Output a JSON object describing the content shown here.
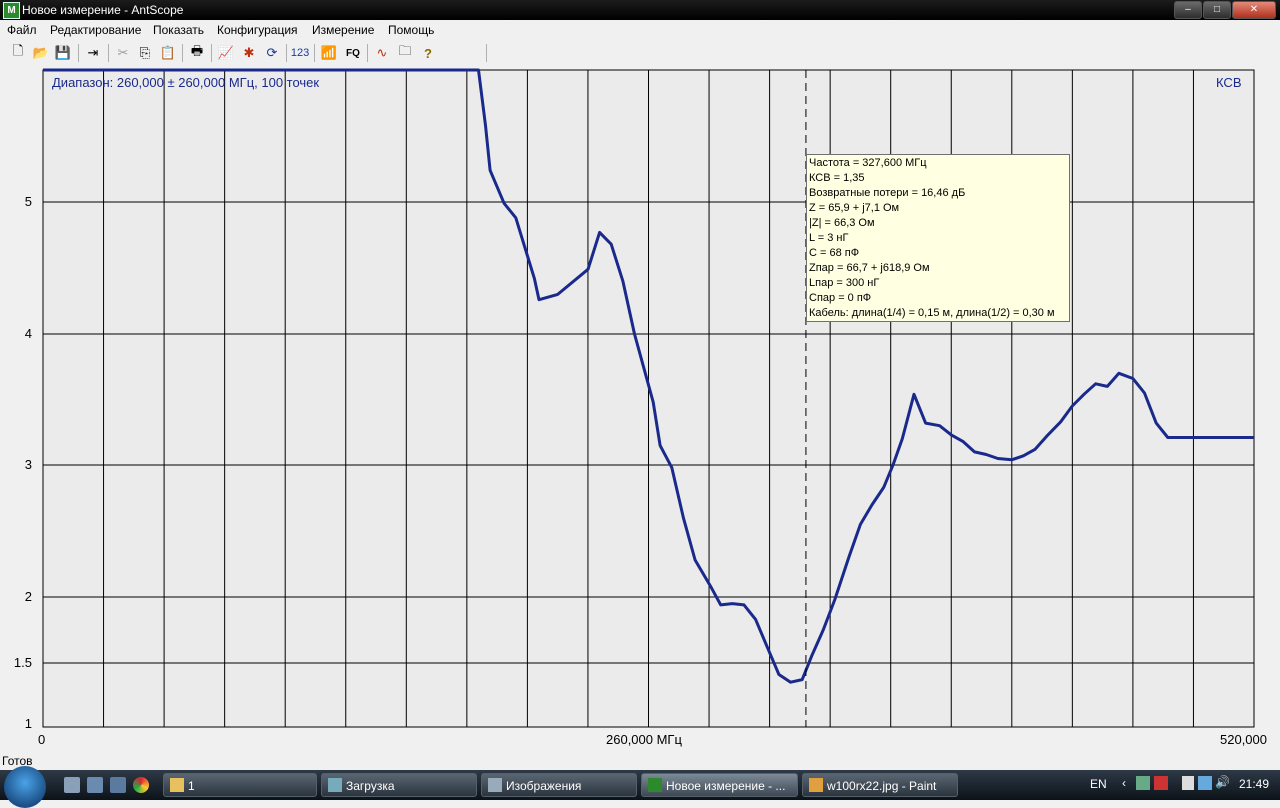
{
  "window": {
    "title": "Новое измерение - AntScope",
    "app_icon": "antscope-icon",
    "controls": {
      "minimize": "–",
      "maximize": "□",
      "close": "✕"
    }
  },
  "menu": [
    "Файл",
    "Редактирование",
    "Показать",
    "Конфигурация",
    "Измерение",
    "Помощь"
  ],
  "toolbar": {
    "buttons": [
      {
        "name": "new-file-icon",
        "glyph": "🗋"
      },
      {
        "name": "open-folder-icon",
        "glyph": "📂"
      },
      {
        "name": "save-icon",
        "glyph": "💾"
      },
      {
        "name": "export-icon",
        "glyph": "⇥"
      },
      {
        "name": "cut-icon",
        "glyph": "✂"
      },
      {
        "name": "copy-icon",
        "glyph": "⎘"
      },
      {
        "name": "paste-icon",
        "glyph": "📋"
      },
      {
        "name": "print-icon",
        "glyph": "🖶"
      },
      {
        "name": "chart-icon",
        "glyph": "📈"
      },
      {
        "name": "star-icon",
        "glyph": "✱"
      },
      {
        "name": "refresh-icon",
        "glyph": "⟳"
      },
      {
        "name": "numbers-icon",
        "glyph": "123"
      },
      {
        "name": "antenna-icon",
        "glyph": "📶"
      },
      {
        "name": "fq-icon",
        "glyph": "FQ"
      },
      {
        "name": "waves-icon",
        "glyph": "∿"
      },
      {
        "name": "folder-list-icon",
        "glyph": "🗀"
      },
      {
        "name": "help-icon",
        "glyph": "?"
      }
    ]
  },
  "plot": {
    "range_label": "Диапазон: 260,000 ± 260,000 МГц, 100 точек",
    "mode_label": "КСВ",
    "x_labels": {
      "left": "0",
      "center": "260,000 МГц",
      "right": "520,000"
    },
    "line_color": "#1a2a8c"
  },
  "chart_data": {
    "type": "line",
    "xlabel": "МГц",
    "ylabel": "КСВ",
    "xlim": [
      0,
      520
    ],
    "y_ticks": [
      "1",
      "1.5",
      "2",
      "3",
      "4",
      "5"
    ],
    "cursor_x": 327.6,
    "series": [
      {
        "x": [
          0,
          187,
          190,
          192,
          198,
          203,
          211,
          213,
          221,
          234,
          239,
          244,
          249,
          254,
          262,
          265,
          270,
          275,
          280,
          287,
          291,
          296,
          301,
          306,
          311,
          316,
          321,
          326,
          330,
          335,
          340,
          346,
          351,
          356,
          361,
          365,
          369,
          374,
          379,
          385,
          390,
          395,
          400,
          405,
          410,
          416,
          421,
          426,
          431,
          437,
          442,
          447,
          452,
          457,
          462,
          468,
          473,
          478,
          483,
          489,
          494,
          499,
          505,
          510,
          515,
          520
        ],
        "y": [
          6.0,
          6.0,
          5.58,
          5.24,
          4.99,
          4.88,
          4.42,
          4.26,
          4.3,
          4.49,
          4.77,
          4.68,
          4.4,
          4.0,
          3.48,
          3.15,
          2.98,
          2.6,
          2.28,
          2.07,
          1.94,
          1.95,
          1.94,
          1.83,
          1.62,
          1.41,
          1.35,
          1.37,
          1.55,
          1.75,
          1.98,
          2.3,
          2.55,
          2.7,
          2.83,
          3.0,
          3.2,
          3.54,
          3.32,
          3.3,
          3.23,
          3.18,
          3.1,
          3.08,
          3.05,
          3.04,
          3.07,
          3.12,
          3.22,
          3.33,
          3.45,
          3.54,
          3.62,
          3.6,
          3.7,
          3.66,
          3.55,
          3.32,
          3.21,
          3.21,
          3.21,
          3.21,
          3.21,
          3.21,
          3.21,
          3.21
        ]
      }
    ]
  },
  "tooltip": {
    "lines": [
      "Частота = 327,600 МГц",
      "КСВ = 1,35",
      "Возвратные потери = 16,46 дБ",
      "Z = 65,9 + j7,1 Ом",
      "|Z| = 66,3 Ом",
      "L = 3 нГ",
      "C = 68 пФ",
      "Zпар = 66,7 + j618,9 Ом",
      "Lпар = 300 нГ",
      "Cпар = 0 пФ",
      "Кабель: длина(1/4) = 0,15 м, длина(1/2) = 0,30 м"
    ]
  },
  "status": "Готов",
  "taskbar": {
    "tasks": [
      {
        "label": "1",
        "active": false
      },
      {
        "label": "Загрузка",
        "active": false
      },
      {
        "label": "Изображения",
        "active": false
      },
      {
        "label": "Новое измерение - ...",
        "active": true
      },
      {
        "label": "w100rx22.jpg - Paint",
        "active": false
      }
    ],
    "lang": "EN",
    "time": "21:49"
  }
}
